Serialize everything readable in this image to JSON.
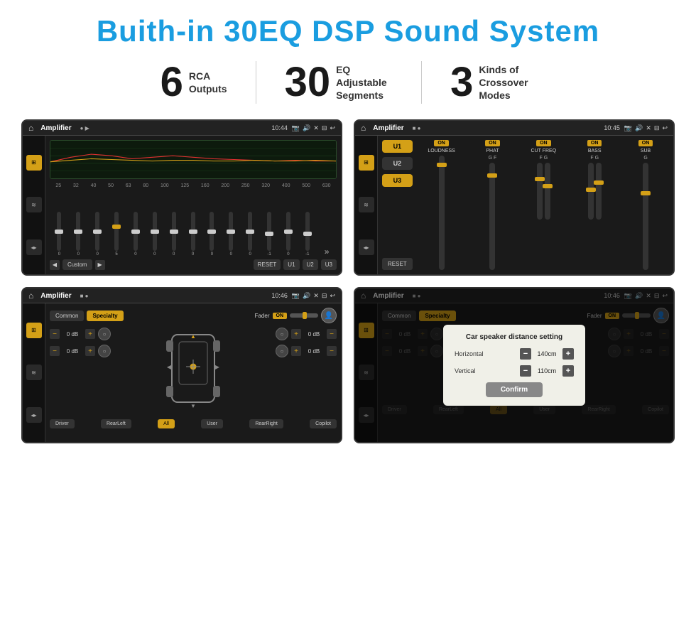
{
  "header": {
    "title": "Buith-in 30EQ DSP Sound System"
  },
  "stats": [
    {
      "number": "6",
      "label": "RCA\nOutputs"
    },
    {
      "number": "30",
      "label": "EQ Adjustable\nSegments"
    },
    {
      "number": "3",
      "label": "Kinds of\nCrossover Modes"
    }
  ],
  "screens": {
    "eq_screen": {
      "title": "Amplifier",
      "time": "10:44",
      "freq_labels": [
        "25",
        "32",
        "40",
        "50",
        "63",
        "80",
        "100",
        "125",
        "160",
        "200",
        "250",
        "320",
        "400",
        "500",
        "630"
      ],
      "slider_vals": [
        "0",
        "0",
        "0",
        "5",
        "0",
        "0",
        "0",
        "0",
        "0",
        "0",
        "0",
        "-1",
        "0",
        "-1"
      ],
      "preset": "Custom",
      "presets": [
        "RESET",
        "U1",
        "U2",
        "U3"
      ]
    },
    "crossover_screen": {
      "title": "Amplifier",
      "time": "10:45",
      "u_buttons": [
        "U1",
        "U2",
        "U3"
      ],
      "controls": [
        "LOUDNESS",
        "PHAT",
        "CUT FREQ",
        "BASS",
        "SUB"
      ],
      "on_labels": [
        "ON",
        "ON",
        "ON",
        "ON",
        "ON"
      ]
    },
    "fader_screen": {
      "title": "Amplifier",
      "time": "10:46",
      "tabs": [
        "Common",
        "Specialty"
      ],
      "fader_label": "Fader",
      "fader_on": "ON",
      "db_values": [
        "0 dB",
        "0 dB",
        "0 dB",
        "0 dB"
      ],
      "bottom_btns": [
        "Driver",
        "RearLeft",
        "All",
        "User",
        "RearRight",
        "Copilot"
      ]
    },
    "dialog_screen": {
      "title": "Amplifier",
      "time": "10:46",
      "tabs": [
        "Common",
        "Specialty"
      ],
      "dialog": {
        "title": "Car speaker distance setting",
        "horizontal_label": "Horizontal",
        "horizontal_val": "140cm",
        "vertical_label": "Vertical",
        "vertical_val": "110cm",
        "confirm_label": "Confirm"
      },
      "db_values": [
        "0 dB",
        "0 dB"
      ],
      "bottom_btns": [
        "Driver",
        "RearLeft",
        "All",
        "User",
        "RearRight",
        "Copilot"
      ]
    }
  },
  "colors": {
    "accent": "#1a9de0",
    "gold": "#d4a017",
    "dark_bg": "#1a1a1a",
    "text_dark": "#1a1a1a"
  }
}
